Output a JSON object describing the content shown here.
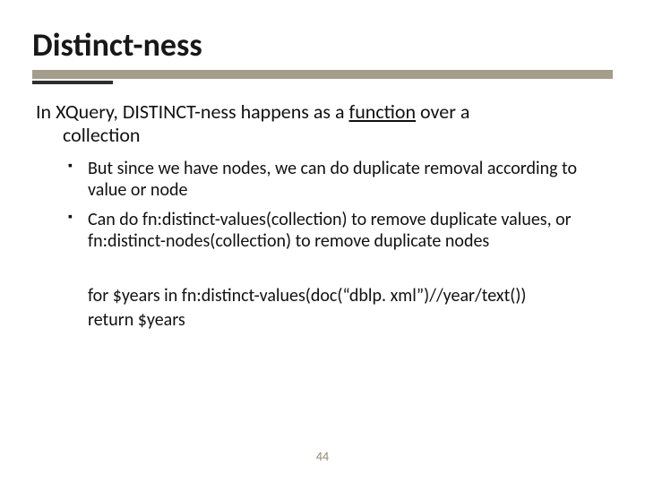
{
  "title": "Distinct-ness",
  "intro": {
    "prefix": "In XQuery, DISTINCT-ness happens as a ",
    "underlined": "function",
    "suffix": " over a",
    "line2": "collection"
  },
  "bullets": [
    "But since we have nodes, we can do duplicate removal according to value or node",
    "Can do fn:distinct-values(collection) to remove duplicate values, or fn:distinct-nodes(collection) to remove duplicate nodes"
  ],
  "code": {
    "line1": "for $years in fn:distinct-values(doc(“dblp. xml”)//year/text())",
    "line2": "return $years"
  },
  "page_number": "44"
}
